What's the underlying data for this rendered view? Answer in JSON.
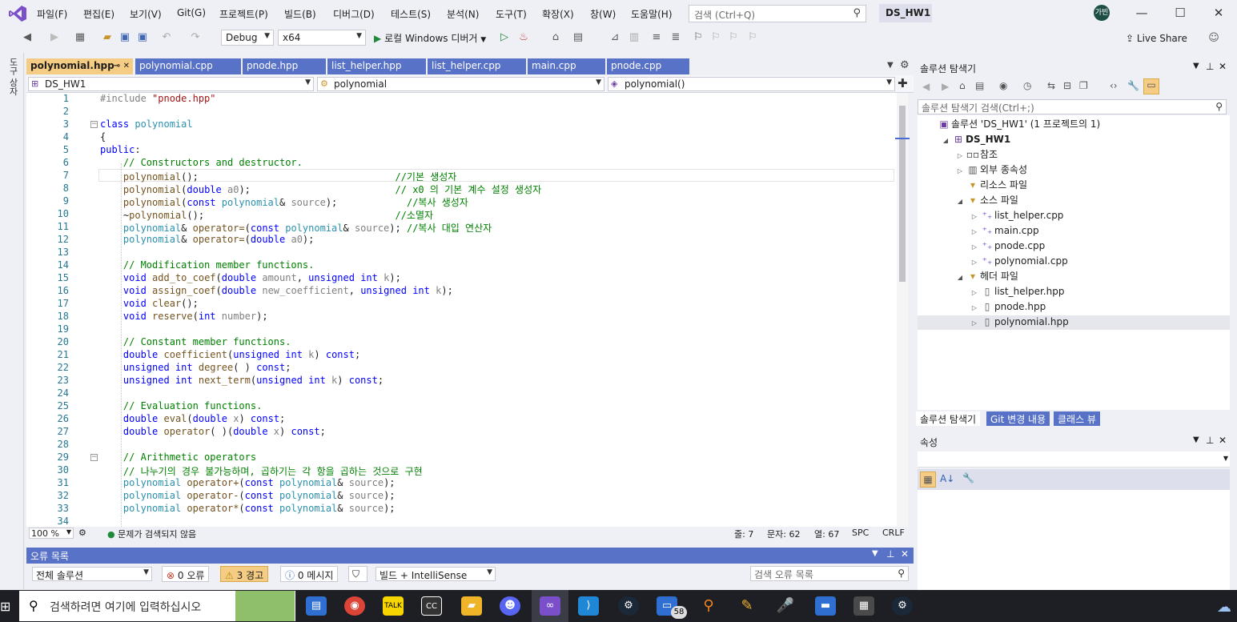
{
  "menu": {
    "items": [
      "파일(F)",
      "편집(E)",
      "보기(V)",
      "Git(G)",
      "프로젝트(P)",
      "빌드(B)",
      "디버그(D)",
      "테스트(S)",
      "분석(N)",
      "도구(T)",
      "확장(X)",
      "창(W)",
      "도움말(H)"
    ],
    "search_placeholder": "검색 (Ctrl+Q)",
    "solution_name": "DS_HW1",
    "avatar_text": "가빈"
  },
  "toolbar": {
    "config": "Debug",
    "platform": "x64",
    "run_label": "로컬 Windows 디버거",
    "live_share": "Live Share"
  },
  "left_strip": {
    "toolbox": "도구 상자"
  },
  "editor": {
    "tabs": [
      {
        "label": "polynomial.hpp",
        "active": true
      },
      {
        "label": "polynomial.cpp",
        "active": false
      },
      {
        "label": "pnode.hpp",
        "active": false
      },
      {
        "label": "list_helper.hpp",
        "active": false
      },
      {
        "label": "list_helper.cpp",
        "active": false
      },
      {
        "label": "main.cpp",
        "active": false
      },
      {
        "label": "pnode.cpp",
        "active": false
      }
    ],
    "nav": {
      "project": "DS_HW1",
      "scope": "polynomial",
      "member": "polynomial()"
    },
    "line_numbers": [
      "1",
      "2",
      "3",
      "4",
      "5",
      "6",
      "7",
      "8",
      "9",
      "10",
      "11",
      "12",
      "13",
      "14",
      "15",
      "16",
      "17",
      "18",
      "19",
      "20",
      "21",
      "22",
      "23",
      "24",
      "25",
      "26",
      "27",
      "28",
      "29",
      "30",
      "31",
      "32",
      "33",
      "34"
    ],
    "status": {
      "zoom": "100 %",
      "issues": "문제가 검색되지 않음",
      "line": "줄: 7",
      "char": "문자: 62",
      "col": "열: 67",
      "spc": "SPC",
      "crlf": "CRLF"
    }
  },
  "error_list": {
    "title": "오류 목록",
    "scope": "전체 솔루션",
    "errors": "0 오류",
    "warnings": "3 경고",
    "messages": "0 메시지",
    "build_filter": "빌드 + IntelliSense",
    "search_placeholder": "검색 오류 목록"
  },
  "solution_explorer": {
    "title": "솔루션 탐색기",
    "search_placeholder": "솔루션 탐색기 검색(Ctrl+;)",
    "tree": [
      {
        "label": "솔루션 'DS_HW1' (1 프로젝트의 1)",
        "depth": 0,
        "exp": "",
        "icon": "solution-icon"
      },
      {
        "label": "DS_HW1",
        "depth": 1,
        "exp": "◢",
        "icon": "project-icon",
        "bold": true
      },
      {
        "label": "참조",
        "depth": 2,
        "exp": "▷",
        "icon": "references-icon"
      },
      {
        "label": "외부 종속성",
        "depth": 2,
        "exp": "▷",
        "icon": "external-deps-icon"
      },
      {
        "label": "리소스 파일",
        "depth": 2,
        "exp": "",
        "icon": "filter-icon"
      },
      {
        "label": "소스 파일",
        "depth": 2,
        "exp": "◢",
        "icon": "filter-icon"
      },
      {
        "label": "list_helper.cpp",
        "depth": 3,
        "exp": "▷",
        "icon": "cpp-file-icon"
      },
      {
        "label": "main.cpp",
        "depth": 3,
        "exp": "▷",
        "icon": "cpp-file-icon"
      },
      {
        "label": "pnode.cpp",
        "depth": 3,
        "exp": "▷",
        "icon": "cpp-file-icon"
      },
      {
        "label": "polynomial.cpp",
        "depth": 3,
        "exp": "▷",
        "icon": "cpp-file-icon"
      },
      {
        "label": "헤더 파일",
        "depth": 2,
        "exp": "◢",
        "icon": "filter-icon"
      },
      {
        "label": "list_helper.hpp",
        "depth": 3,
        "exp": "▷",
        "icon": "header-file-icon"
      },
      {
        "label": "pnode.hpp",
        "depth": 3,
        "exp": "▷",
        "icon": "header-file-icon"
      },
      {
        "label": "polynomial.hpp",
        "depth": 3,
        "exp": "▷",
        "icon": "header-file-icon"
      }
    ],
    "tabs": [
      "솔루션 탐색기",
      "Git 변경 내용",
      "클래스 뷰"
    ]
  },
  "properties": {
    "title": "속성"
  },
  "taskbar": {
    "search_placeholder": "검색하려면 여기에 입력하십시오",
    "badge": "58"
  },
  "colors": {
    "tab_active": "#f5cc84",
    "tab_inactive": "#5872c8",
    "keyword": "#0000ff",
    "type": "#2b91af",
    "comment": "#008000",
    "string": "#a31515"
  }
}
